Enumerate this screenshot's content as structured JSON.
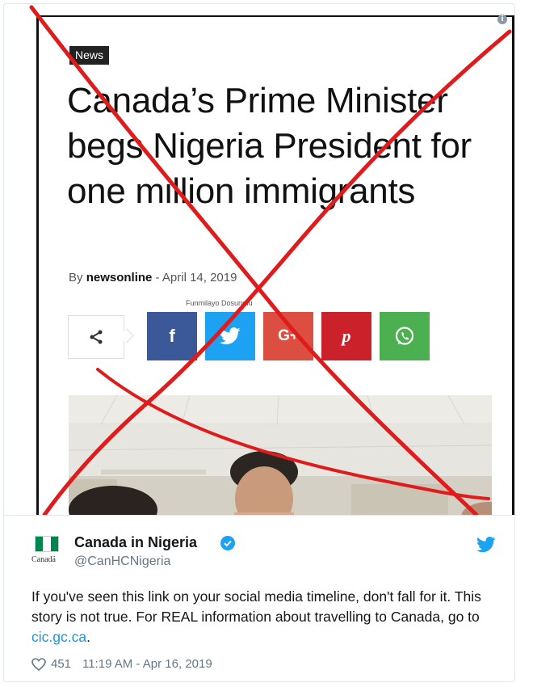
{
  "article": {
    "tag": "News",
    "headline": "Canada’s Prime Minister begs Nigeria President for one million immigrants",
    "byline_prefix": "By",
    "author": "newsonline",
    "byline_sep": "-",
    "date": "April 14, 2019",
    "photo_credit": "Funmilayo Dosunmu",
    "share_buttons": [
      {
        "label": "f",
        "icon": "facebook-icon",
        "color": "#3b5998"
      },
      {
        "label": "",
        "icon": "twitter-icon",
        "color": "#1da1f2"
      },
      {
        "label": "G+",
        "icon": "google-plus-icon",
        "color": "#dc4e41"
      },
      {
        "label": "p",
        "icon": "pinterest-icon",
        "color": "#ca212a"
      },
      {
        "label": "",
        "icon": "whatsapp-icon",
        "color": "#4caf50"
      }
    ]
  },
  "overlay": {
    "color": "#e01b1b",
    "meaning": "red-x-cross-out"
  },
  "tweet": {
    "name": "Canada in Nigeria",
    "handle": "@CanHCNigeria",
    "avatar_wordmark": "Canadä",
    "text_before_link": "If you've seen this link on your social media timeline, don't fall for it.  This story is not true.  For REAL information about travelling to Canada, go to ",
    "link": "cic.gc.ca",
    "text_after_link": ".",
    "likes": "451",
    "timestamp": "11:19 AM - Apr 16, 2019",
    "accent": "#1da1f2"
  }
}
